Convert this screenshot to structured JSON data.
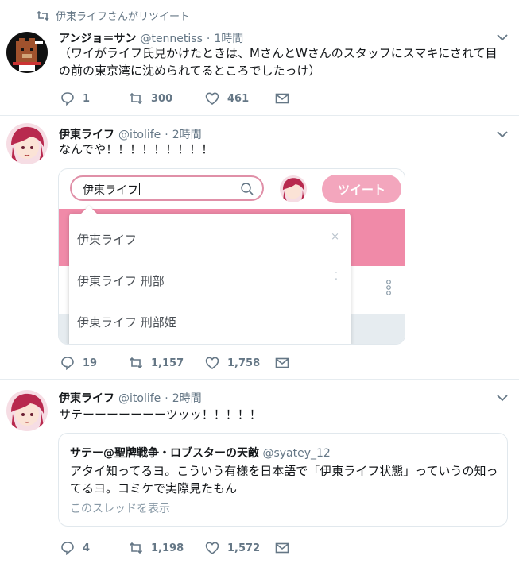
{
  "tweets": [
    {
      "retweet_banner": "伊東ライフさんがリツイート",
      "name": "アンジョ＝サン",
      "handle": "@tennetiss",
      "dot": "·",
      "time": "1時間",
      "text": "（ワイがライフ氏見かけたときは、MさんとWさんのスタッフにスマキにされて目の前の東京湾に沈められてるところでしたっけ）",
      "reply_count": "1",
      "retweet_count": "300",
      "like_count": "461"
    },
    {
      "name": "伊東ライフ",
      "handle": "@itolife",
      "dot": "·",
      "time": "2時間",
      "text": "なんでや！！！！！！！！！",
      "reply_count": "19",
      "retweet_count": "1,157",
      "like_count": "1,758",
      "media": {
        "search_value": "伊東ライフ",
        "tweet_button": "ツイート",
        "suggestions": [
          "伊東ライフ",
          "伊東ライフ 刑部",
          "伊東ライフ 刑部姫"
        ],
        "suggestion_marks": [
          "×",
          "⁚"
        ]
      }
    },
    {
      "name": "伊東ライフ",
      "handle": "@itolife",
      "dot": "·",
      "time": "2時間",
      "text": "サテーーーーーーーツッッ！！！！！",
      "reply_count": "4",
      "retweet_count": "1,198",
      "like_count": "1,572",
      "quote": {
        "name": "サテー@聖牌戦争・ロブスターの天敵",
        "handle": "@syatey_12",
        "text": "アタイ知ってるヨ。こういう有様を日本語で「伊東ライフ状態」っていうの知ってるヨ。コミケで実際見たもん",
        "thread_link": "このスレッドを表示"
      }
    }
  ],
  "colors": {
    "accent": "#f08aa8",
    "muted": "#657786",
    "border": "#e6ecf0"
  },
  "icons": [
    "retweet-icon",
    "reply-icon",
    "like-icon",
    "message-icon",
    "chevron-down-icon",
    "search-icon",
    "kebab-icon"
  ]
}
